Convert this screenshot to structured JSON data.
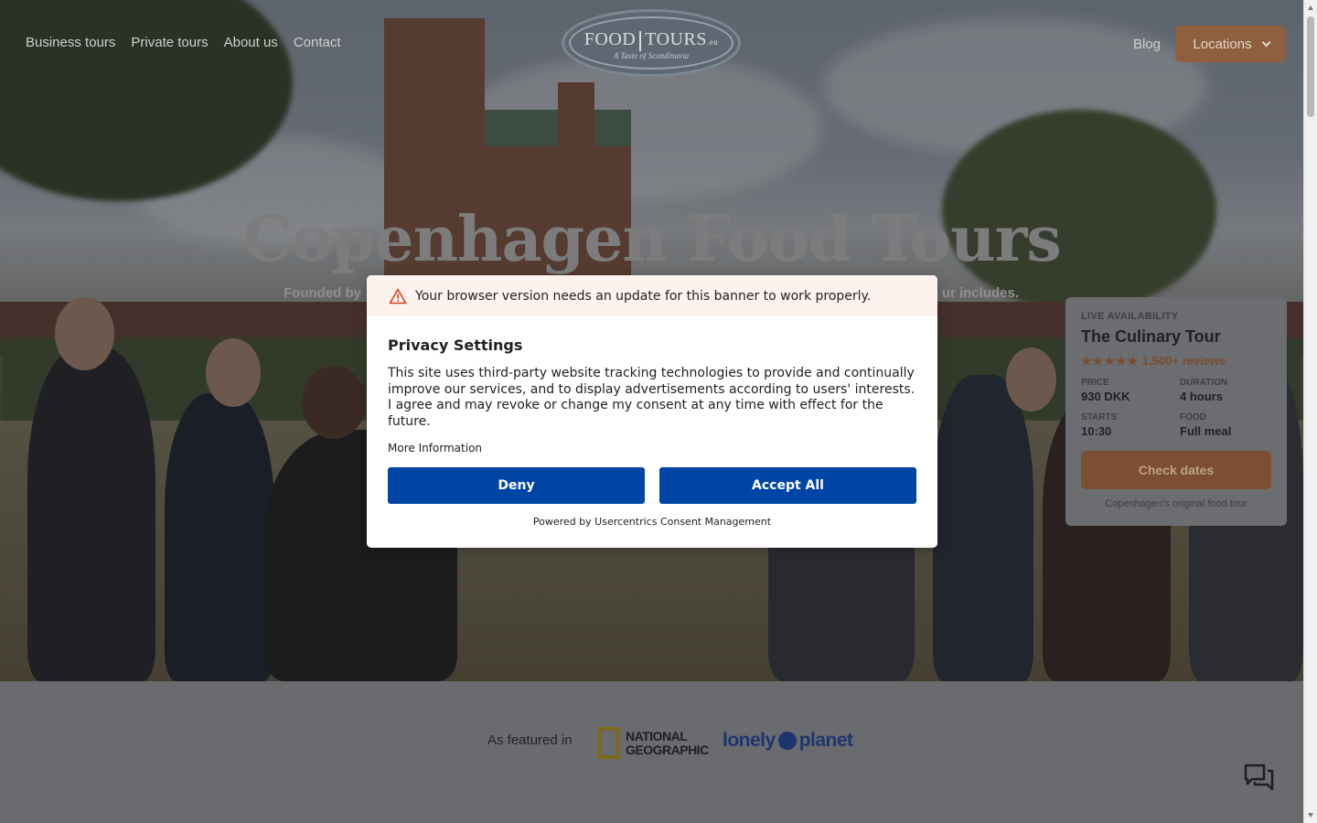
{
  "nav": {
    "left_links": [
      "Business tours",
      "Private tours",
      "About us",
      "Contact"
    ],
    "blog_label": "Blog",
    "locations_label": "Locations"
  },
  "logo": {
    "word_food": "FOOD",
    "word_tours": "TOURS",
    "suffix": ".eu",
    "tagline": "A Taste of Scandinavia"
  },
  "hero": {
    "title": "Copenhagen Food Tours",
    "subtitle_left": "Founded by",
    "subtitle_right": "ur includes."
  },
  "availability_card": {
    "live_label": "LIVE AVAILABILITY",
    "tour_name": "The Culinary Tour",
    "stars": "★★★★★",
    "reviews": "1,500+ reviews",
    "price_label": "PRICE",
    "price_value": "930 DKK",
    "duration_label": "DURATION",
    "duration_value": "4 hours",
    "starts_label": "STARTS",
    "starts_value": "10:30",
    "food_label": "FOOD",
    "food_value": "Full meal",
    "check_button": "Check dates",
    "footnote": "Copenhagen's original food tour"
  },
  "featured": {
    "label": "As featured in",
    "natgeo_line1": "NATIONAL",
    "natgeo_line2": "GEOGRAPHIC",
    "lonely_left": "lonely",
    "lonely_right": "planet"
  },
  "consent": {
    "warning": "Your browser version needs an update for this banner to work properly.",
    "title": "Privacy Settings",
    "body": "This site uses third-party website tracking technologies to provide and continually improve our services, and to display advertisements according to users' interests. I agree and may revoke or change my consent at any time with effect for the future.",
    "more_info": "More Information",
    "deny": "Deny",
    "accept_all": "Accept All",
    "powered_by": "Powered by Usercentrics Consent Management"
  },
  "colors": {
    "consent_button": "#0045a5",
    "accent_brown": "#c58a5e",
    "warning_bg": "#fef2ee",
    "warning_icon": "#d9401f"
  },
  "icons": [
    "warning-icon",
    "chevron-down-icon",
    "chat-icon",
    "globe-icon"
  ]
}
